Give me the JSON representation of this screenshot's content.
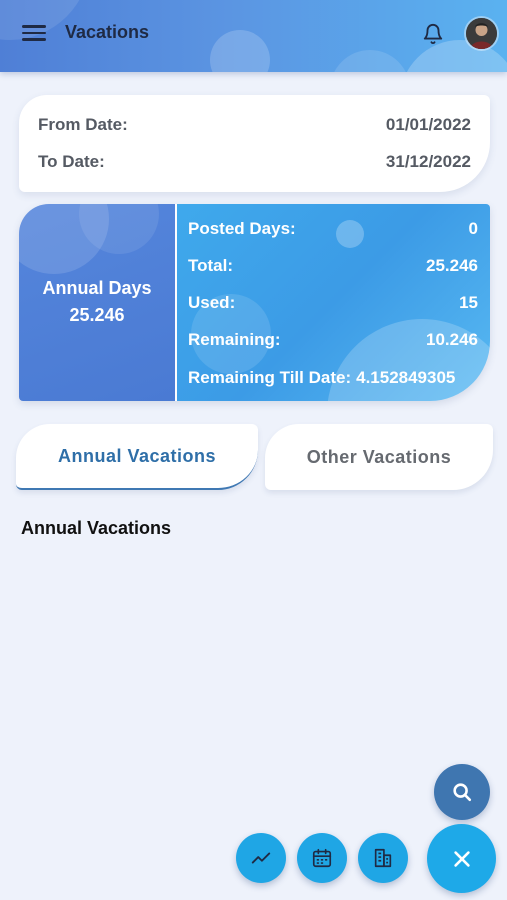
{
  "header": {
    "title": "Vacations",
    "icons": [
      "menu-icon",
      "bell-icon",
      "avatar"
    ]
  },
  "dates": {
    "from_label": "From Date:",
    "from_value": "01/01/2022",
    "to_label": "To Date:",
    "to_value": "31/12/2022"
  },
  "annual_days": {
    "label": "Annual Days",
    "value": "25.246"
  },
  "stats": {
    "posted_label": "Posted Days:",
    "posted_value": "0",
    "total_label": "Total:",
    "total_value": "25.246",
    "used_label": "Used:",
    "used_value": "15",
    "remaining_label": "Remaining:",
    "remaining_value": "10.246",
    "remaining_till_label": "Remaining Till Date:",
    "remaining_till_value": "4.152849305"
  },
  "tabs": {
    "annual": "Annual Vacations",
    "other": "Other Vacations",
    "active": "annual"
  },
  "section": {
    "title": "Annual Vacations"
  },
  "fabs": {
    "icons": [
      "search-icon",
      "trend-icon",
      "calendar-icon",
      "building-icon",
      "close-icon"
    ]
  },
  "colors": {
    "header_gradient_start": "#4f7fd6",
    "header_gradient_end": "#5ab2f0",
    "stats_left": "#4a7ad3",
    "stats_right": "#3fa9ec",
    "tab_active_text": "#2f6fa8",
    "fab_primary": "#1ea9e8",
    "fab_search": "#3f76b0",
    "background": "#eef2fb"
  }
}
